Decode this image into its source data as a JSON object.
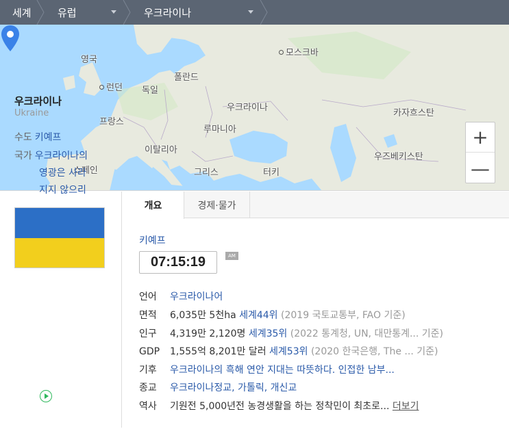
{
  "breadcrumb": {
    "world": "세계",
    "region": "유럽",
    "country": "우크라이나"
  },
  "map": {
    "labels": {
      "uk": "영국",
      "moscow": "모스크바",
      "london": "런던",
      "germany": "독일",
      "poland": "폴란드",
      "ukraine": "우크라이나",
      "kazakhstan": "카자흐스탄",
      "france": "프랑스",
      "romania": "루마니아",
      "italy": "이탈리아",
      "uzbekistan": "우즈베키스탄",
      "spain": "스페인",
      "greece": "그리스",
      "turkey": "터키"
    },
    "zoom_in": "+",
    "zoom_out": "—"
  },
  "country": {
    "name": "우크라이나",
    "name_en": "Ukraine",
    "capital_label": "수도",
    "capital": "키예프",
    "anthem_label": "국가",
    "anthem_line1": "우크라이나의",
    "anthem_line2": "영광은 사라",
    "anthem_line3": "지지 않으리"
  },
  "tabs": {
    "overview": "개요",
    "economy": "경제·물가"
  },
  "info": {
    "city": "키예프",
    "time": "07:15:19",
    "ampm": "AM",
    "rows": {
      "language": {
        "key": "언어",
        "value": "우크라이나어"
      },
      "area": {
        "key": "면적",
        "value": "6,035만 5천ha",
        "rank": "세계44위",
        "source": "(2019 국토교통부, FAO 기준)"
      },
      "population": {
        "key": "인구",
        "value": "4,319만 2,120명",
        "rank": "세계35위",
        "source": "(2022 통계청, UN, 대만통계... 기준)"
      },
      "gdp": {
        "key": "GDP",
        "value": "1,555억 8,201만 달러",
        "rank": "세계53위",
        "source": "(2020 한국은행, The ...   기준)"
      },
      "climate": {
        "key": "기후",
        "value": "우크라이나의 흑해 연안 지대는 따뜻하다. 인접한 남부..."
      },
      "religion": {
        "key": "종교",
        "value": "우크라이나정교, 가톨릭, 개신교"
      },
      "history": {
        "key": "역사",
        "value": "기원전 5,000년전 농경생활을 하는 정착민이 최초로...",
        "more": "더보기"
      }
    }
  },
  "colors": {
    "topbar": "#5b6573",
    "link": "#2a5aa9",
    "flag_blue": "#2c6fc6",
    "flag_yellow": "#f2cf1d",
    "pin": "#3a82e8"
  }
}
